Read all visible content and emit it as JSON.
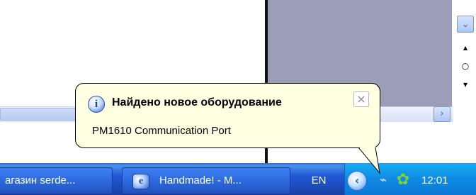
{
  "balloon": {
    "title": "Найдено новое оборудование",
    "message": "PM1610 Communication Port",
    "info_icon_glyph": "i",
    "close_glyph": "×"
  },
  "taskbar": {
    "tasks": [
      {
        "label": "агазин serde..."
      },
      {
        "label": "Handmade! - M...",
        "icon": "e"
      }
    ],
    "language": "EN",
    "clock": "12:01",
    "tray_chevron_glyph": "‹",
    "tray_icons": [
      "network-plug-icon",
      "flower-icon"
    ]
  },
  "window": {
    "scroll_right_glyph": "›",
    "dropdown_glyph": "⌄",
    "side_tool_glyphs": [
      "▴",
      "○",
      "▾"
    ]
  }
}
